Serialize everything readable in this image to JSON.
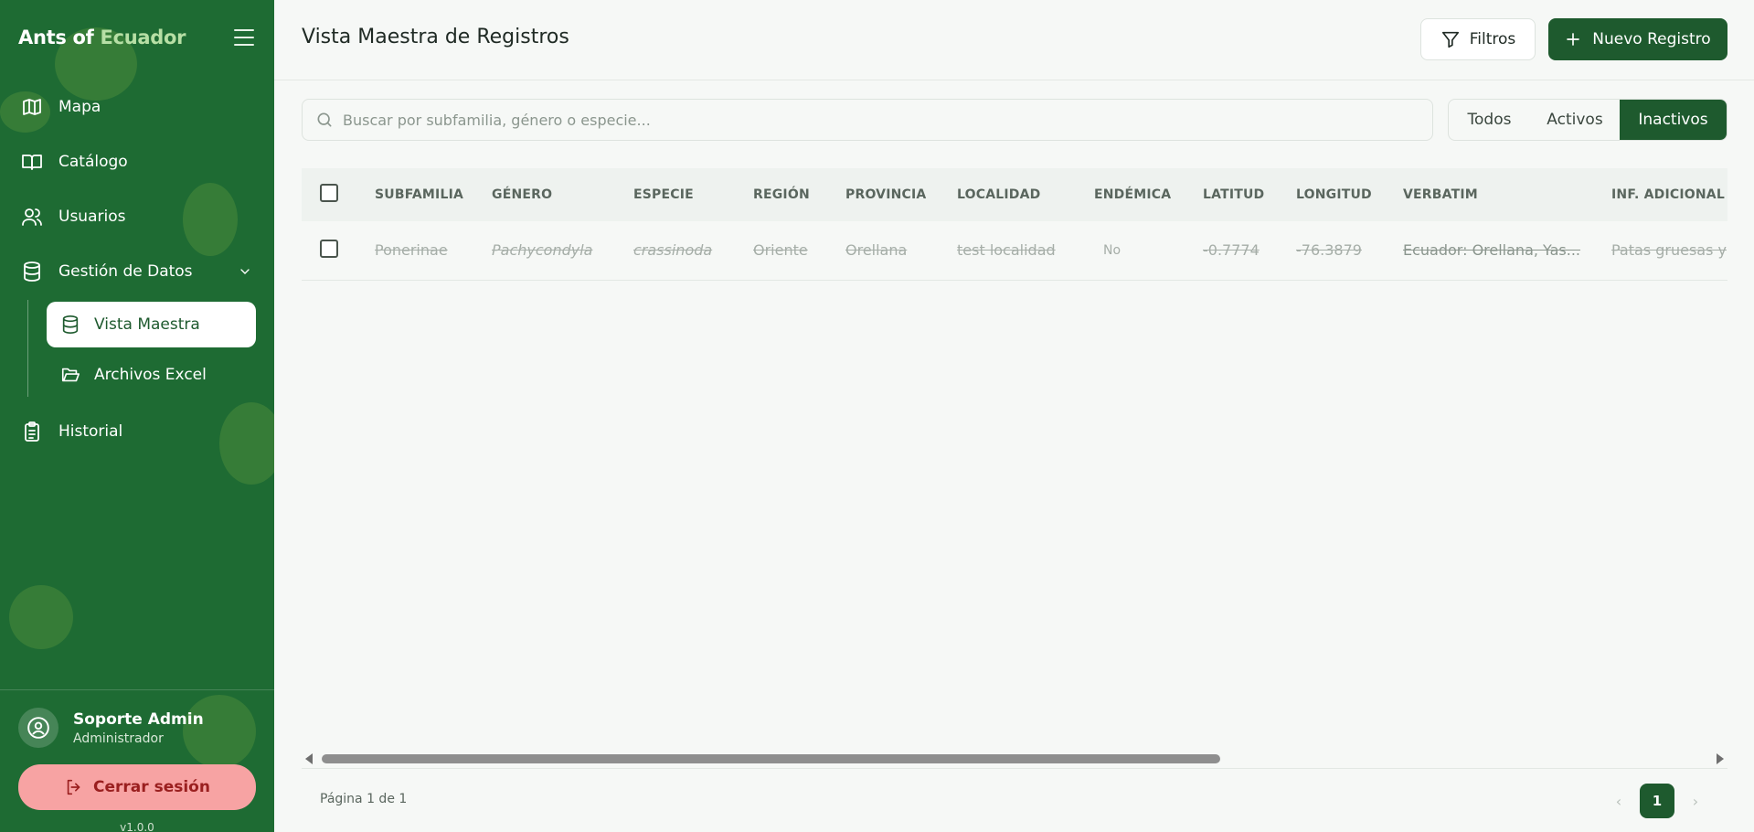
{
  "brand": {
    "part1": "Ants of",
    "part2": "Ecuador"
  },
  "sidebar": {
    "items": [
      {
        "label": "Mapa",
        "icon": "map-icon"
      },
      {
        "label": "Catálogo",
        "icon": "book-open-icon"
      },
      {
        "label": "Usuarios",
        "icon": "users-icon"
      },
      {
        "label": "Gestión de Datos",
        "icon": "database-icon"
      },
      {
        "label": "Historial",
        "icon": "clipboard-list-icon"
      }
    ],
    "subitems": [
      {
        "label": "Vista Maestra",
        "icon": "database-icon",
        "active": true
      },
      {
        "label": "Archivos Excel",
        "icon": "folder-open-icon",
        "active": false
      }
    ],
    "user": {
      "name": "Soporte Admin",
      "role": "Administrador"
    },
    "logout_label": "Cerrar sesión",
    "version": "v1.0.0"
  },
  "header": {
    "title": "Vista Maestra de Registros",
    "filter_label": "Filtros",
    "new_label": "Nuevo Registro"
  },
  "search": {
    "placeholder": "Buscar por subfamilia, género o especie...",
    "value": ""
  },
  "status_filter": {
    "options": [
      "Todos",
      "Activos",
      "Inactivos"
    ],
    "selected": "Inactivos"
  },
  "table": {
    "columns": [
      "SUBFAMILIA",
      "GÉNERO",
      "ESPECIE",
      "REGIÓN",
      "PROVINCIA",
      "LOCALIDAD",
      "ENDÉMICA",
      "LATITUD",
      "LONGITUD",
      "VERBATIM",
      "INF. ADICIONAL"
    ],
    "rows": [
      {
        "subfamilia": "Ponerinae",
        "genero": "Pachycondyla",
        "especie": "crassinoda",
        "region": "Oriente",
        "provincia": "Orellana",
        "localidad": "test localidad",
        "endemica": "No",
        "latitud": "-0.7774",
        "longitud": "-76.3879",
        "verbatim": "Ecuador: Orellana, Yas...",
        "inf_adicional": "Patas gruesas y"
      }
    ]
  },
  "scroll": {
    "horizontal_fraction": 0.65
  },
  "pagination": {
    "info": "Página 1 de 1",
    "current": "1",
    "prev": "‹",
    "next": "›"
  },
  "colors": {
    "sidebar_bg": "#1e6b33",
    "primary": "#1e5a2e",
    "logout_bg": "#f7a3a3"
  }
}
